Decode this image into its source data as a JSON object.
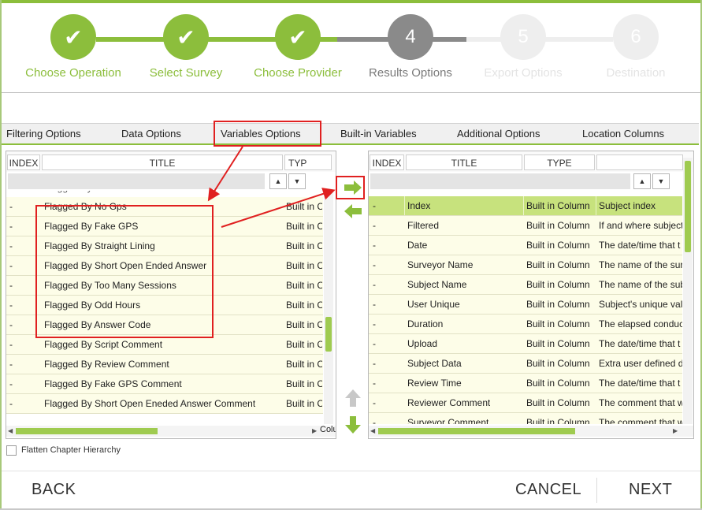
{
  "stepper": {
    "steps": [
      {
        "symbol": "✔",
        "label": "Choose Operation"
      },
      {
        "symbol": "✔",
        "label": "Select Survey"
      },
      {
        "symbol": "✔",
        "label": "Choose Provider"
      },
      {
        "symbol": "4",
        "label": "Results Options"
      },
      {
        "symbol": "5",
        "label": "Export Options"
      },
      {
        "symbol": "6",
        "label": "Destination"
      }
    ]
  },
  "tabs": [
    "Filtering Options",
    "Data Options",
    "Variables Options",
    "Built-in Variables",
    "Additional Options",
    "Location Columns"
  ],
  "left_grid": {
    "headers": {
      "index": "INDEX",
      "title": "TITLE",
      "type": "TYP"
    },
    "partial_row_title": "Flagged By ...",
    "rows": [
      {
        "index": "-",
        "title": "Flagged By No Gps",
        "type": "Built in C"
      },
      {
        "index": "-",
        "title": "Flagged By Fake GPS",
        "type": "Built in C"
      },
      {
        "index": "-",
        "title": "Flagged By Straight Lining",
        "type": "Built in C"
      },
      {
        "index": "-",
        "title": "Flagged By Short Open Ended Answer",
        "type": "Built in C"
      },
      {
        "index": "-",
        "title": "Flagged By Too Many Sessions",
        "type": "Built in C"
      },
      {
        "index": "-",
        "title": "Flagged By Odd Hours",
        "type": "Built in C"
      },
      {
        "index": "-",
        "title": "Flagged By Answer Code",
        "type": "Built in C"
      },
      {
        "index": "-",
        "title": "Flagged By Script Comment",
        "type": "Built in C"
      },
      {
        "index": "-",
        "title": "Flagged By Review Comment",
        "type": "Built in C"
      },
      {
        "index": "-",
        "title": "Flagged By Fake GPS Comment",
        "type": "Built in C"
      },
      {
        "index": "-",
        "title": "Flagged By Short Open Eneded Answer Comment",
        "type": "Built in C"
      }
    ],
    "hscroll_tail": "Colu"
  },
  "right_grid": {
    "headers": {
      "index": "INDEX",
      "title": "TITLE",
      "type": "TYPE"
    },
    "rows": [
      {
        "index": "-",
        "title": "Index",
        "type": "Built in Column",
        "desc": "Subject index"
      },
      {
        "index": "-",
        "title": "Filtered",
        "type": "Built in Column",
        "desc": "If and where subject"
      },
      {
        "index": "-",
        "title": "Date",
        "type": "Built in Column",
        "desc": "The date/time that t"
      },
      {
        "index": "-",
        "title": "Surveyor Name",
        "type": "Built in Column",
        "desc": "The name of the sur"
      },
      {
        "index": "-",
        "title": "Subject Name",
        "type": "Built in Column",
        "desc": "The name of the sub"
      },
      {
        "index": "-",
        "title": "User Unique",
        "type": "Built in Column",
        "desc": "Subject's unique val"
      },
      {
        "index": "-",
        "title": "Duration",
        "type": "Built in Column",
        "desc": "The elapsed conduc"
      },
      {
        "index": "-",
        "title": "Upload",
        "type": "Built in Column",
        "desc": "The date/time that t"
      },
      {
        "index": "-",
        "title": "Subject Data",
        "type": "Built in Column",
        "desc": "Extra user defined da"
      },
      {
        "index": "-",
        "title": "Review Time",
        "type": "Built in Column",
        "desc": "The date/time that t"
      },
      {
        "index": "-",
        "title": "Reviewer Comment",
        "type": "Built in Column",
        "desc": "The comment that w"
      },
      {
        "index": "-",
        "title": "Surveyor Comment",
        "type": "Built in Column",
        "desc": "The comment that w"
      }
    ]
  },
  "flatten_label": "Flatten Chapter Hierarchy",
  "footer": {
    "back": "BACK",
    "cancel": "CANCEL",
    "next": "NEXT"
  },
  "colors": {
    "accent": "#8cbe3c",
    "annotation": "#e02020"
  }
}
